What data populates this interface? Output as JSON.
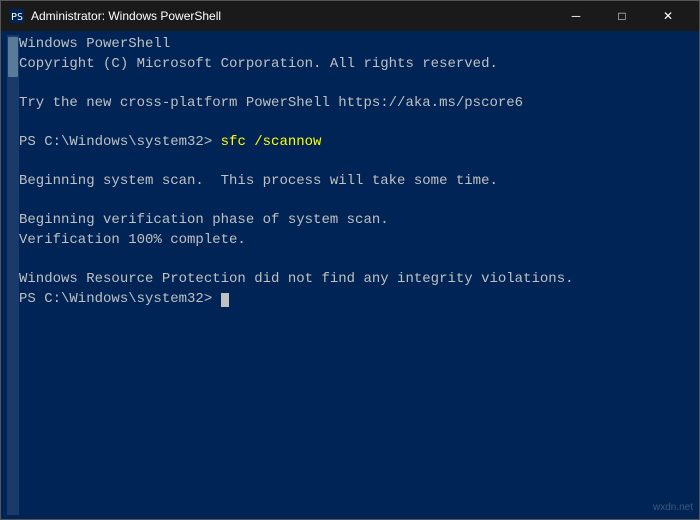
{
  "window": {
    "title": "Administrator: Windows PowerShell",
    "icon": "powershell"
  },
  "titlebar": {
    "minimize_label": "─",
    "maximize_label": "□",
    "close_label": "✕"
  },
  "console": {
    "lines": [
      {
        "type": "normal",
        "text": "Windows PowerShell"
      },
      {
        "type": "normal",
        "text": "Copyright (C) Microsoft Corporation. All rights reserved."
      },
      {
        "type": "empty",
        "text": ""
      },
      {
        "type": "normal",
        "text": "Try the new cross-platform PowerShell https://aka.ms/pscore6"
      },
      {
        "type": "empty",
        "text": ""
      },
      {
        "type": "prompt_cmd",
        "prompt": "PS C:\\Windows\\system32> ",
        "command": "sfc /scannow"
      },
      {
        "type": "empty",
        "text": ""
      },
      {
        "type": "normal",
        "text": "Beginning system scan.  This process will take some time."
      },
      {
        "type": "empty",
        "text": ""
      },
      {
        "type": "normal",
        "text": "Beginning verification phase of system scan."
      },
      {
        "type": "normal",
        "text": "Verification 100% complete."
      },
      {
        "type": "empty",
        "text": ""
      },
      {
        "type": "normal",
        "text": "Windows Resource Protection did not find any integrity violations."
      },
      {
        "type": "prompt_only",
        "prompt": "PS C:\\Windows\\system32> "
      }
    ]
  },
  "watermark": {
    "text": "wxdn.net"
  }
}
